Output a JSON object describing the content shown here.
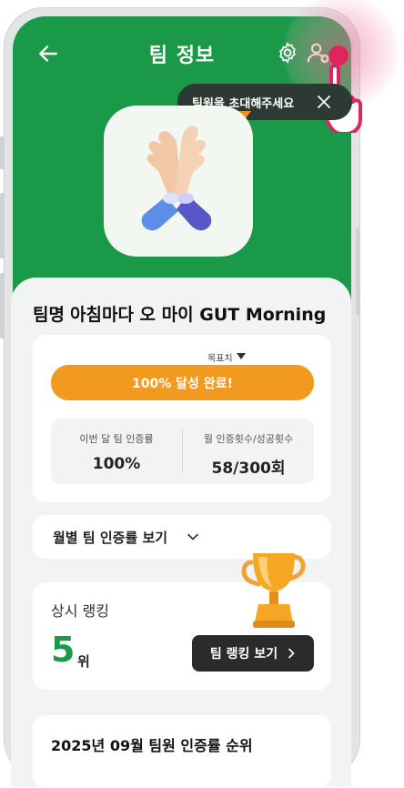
{
  "header": {
    "title": "팀 정보",
    "back_icon": "arrow-left-icon",
    "settings_icon": "gear-icon",
    "invite_icon": "user-plus-icon",
    "background_color": "#1a9a48"
  },
  "tooltip": {
    "text": "팀원을 초대해주세요",
    "close_icon": "close-icon"
  },
  "team": {
    "name_label": "팀명",
    "name": "아침마다 오 마이 GUT Morning",
    "image_icon": "high-five-icon"
  },
  "goal": {
    "label": "목표치",
    "progress_text": "100% 달성 완료!",
    "progress_percent": 100,
    "progress_color": "#f29a1f",
    "stats": [
      {
        "label": "이번 달 팀 인증률",
        "value": "100%"
      },
      {
        "label": "월 인증횟수/성공횟수",
        "value": "58/300회"
      }
    ]
  },
  "monthly": {
    "label": "월별 팀 인증률 보기"
  },
  "ranking": {
    "title": "상시 랭킹",
    "rank": "5",
    "rank_suffix": "위",
    "button_label": "팀 랭킹 보기",
    "rank_color": "#1a9a48"
  },
  "members": {
    "title": "2025년 09월 팀원 인증률 순위"
  }
}
